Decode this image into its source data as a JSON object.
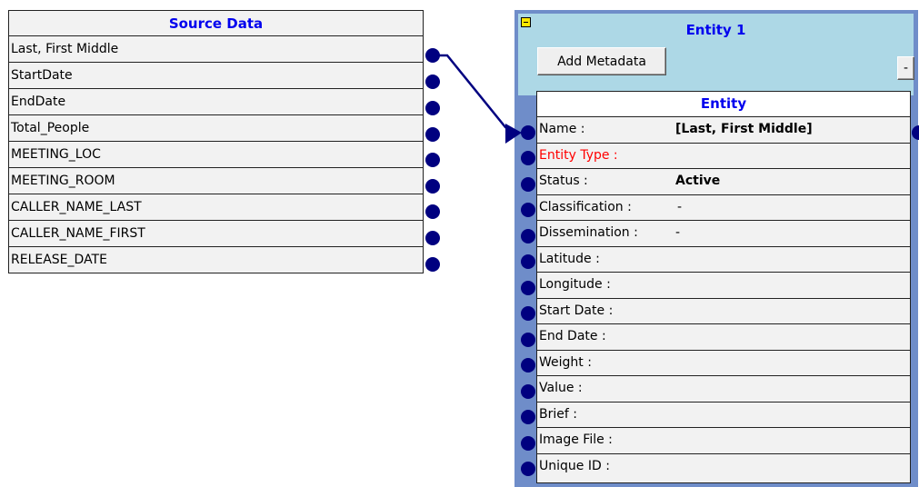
{
  "source": {
    "title": "Source Data",
    "fields": [
      "Last, First Middle",
      "StartDate",
      "EndDate",
      "Total_People",
      "MEETING_LOC",
      "MEETING_ROOM",
      "CALLER_NAME_LAST",
      "CALLER_NAME_FIRST",
      "RELEASE_DATE"
    ]
  },
  "entity_panel": {
    "title": "Entity 1",
    "add_metadata_label": "Add Metadata",
    "minus_label": "-",
    "table_title": "Entity",
    "rows": [
      {
        "label": "Name :",
        "value": "[Last, First Middle]"
      },
      {
        "label": "Entity Type :",
        "value": ""
      },
      {
        "label": "Status :",
        "value": "Active"
      },
      {
        "label": "Classification :",
        "value": "-"
      },
      {
        "label": "Dissemination :",
        "value": "-"
      },
      {
        "label": "Latitude :",
        "value": ""
      },
      {
        "label": "Longitude :",
        "value": ""
      },
      {
        "label": "Start Date :",
        "value": ""
      },
      {
        "label": "End Date :",
        "value": ""
      },
      {
        "label": "Weight :",
        "value": ""
      },
      {
        "label": "Value :",
        "value": ""
      },
      {
        "label": "Brief :",
        "value": ""
      },
      {
        "label": "Image File :",
        "value": ""
      },
      {
        "label": "Unique ID :",
        "value": ""
      }
    ]
  },
  "colors": {
    "title_text": "#0000ee",
    "required_label": "#ff0000",
    "connector_dot": "#000080",
    "entity_frame": "#6f8dc9",
    "entity_header": "#add8e6"
  },
  "icons": {
    "collapse": "collapse-toggle-icon",
    "connector": "connector-dot-icon",
    "link": "mapping-arrow-icon"
  }
}
